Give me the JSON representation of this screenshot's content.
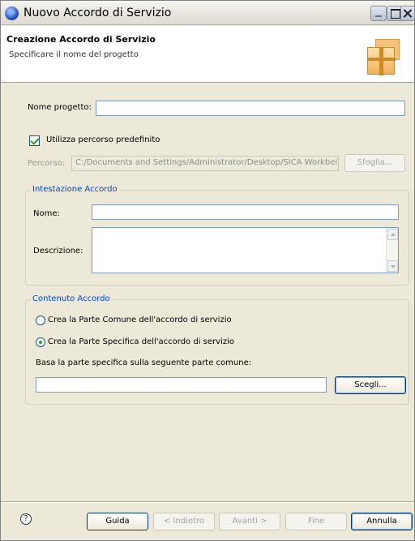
{
  "window": {
    "title": "Nuovo Accordo di Servizio",
    "icon": "eclipse-globe-icon"
  },
  "header": {
    "title": "Creazione Accordo di Servizio",
    "description": "Specificare il nome del progetto",
    "image": "package-boxes-icon"
  },
  "project": {
    "name_label": "Nome progetto:",
    "name_value": "",
    "use_default_label": "Utilizza percorso predefinito",
    "use_default_checked": true,
    "path_label": "Percorso:",
    "path_value": "C:/Documents and Settings/Administrator/Desktop/SICA Workbei",
    "browse_label": "Sfoglia..."
  },
  "intestazione": {
    "group_title": "Intestazione Accordo",
    "name_label": "Nome:",
    "name_value": "",
    "description_label": "Descrizione:",
    "description_value": ""
  },
  "contenuto": {
    "group_title": "Contenuto Accordo",
    "radio_common_label": "Crea la Parte Comune dell'accordo di servizio",
    "radio_specific_label": "Crea la Parte Specifica dell'accordo di servizio",
    "selected_option": "specific",
    "base_label": "Basa la parte specifica sulla seguente parte comune:",
    "base_value": "",
    "choose_label": "Scegli..."
  },
  "footer": {
    "help_glyph": "?",
    "guida": "Guida",
    "back": "< Indietro",
    "next": "Avanti >",
    "finish": "Fine",
    "cancel": "Annulla"
  }
}
